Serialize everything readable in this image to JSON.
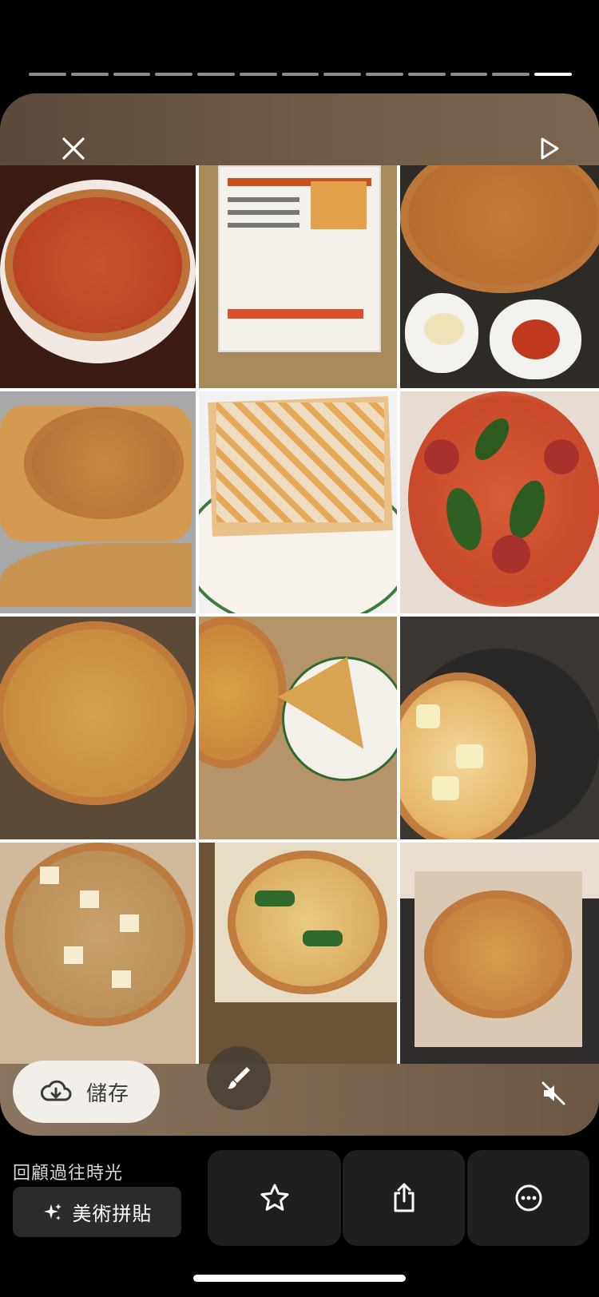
{
  "story": {
    "progress": {
      "segments": 13,
      "active_index": 12
    }
  },
  "toolbar": {
    "close_icon": "close-icon",
    "play_icon": "play-icon",
    "mute_icon": "speaker-muted-icon"
  },
  "actions": {
    "save_label": "儲存",
    "save_icon": "cloud-download-icon",
    "brush_icon": "paintbrush-icon"
  },
  "memories": {
    "section_label": "回顧過往時光",
    "collage_label": "美術拼貼",
    "collage_icon": "sparkles-icon"
  },
  "bottom_actions": [
    {
      "name": "favorite",
      "icon": "star-icon"
    },
    {
      "name": "share",
      "icon": "share-icon"
    },
    {
      "name": "more",
      "icon": "more-icon"
    }
  ],
  "colors": {
    "background": "#000000",
    "pill": "#f2efea",
    "action_button": "#1f1f1f"
  }
}
